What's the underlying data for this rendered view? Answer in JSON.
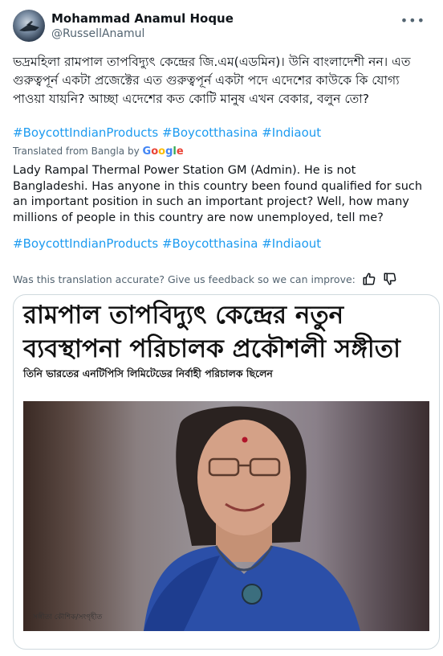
{
  "author": {
    "name": "Mohammad Anamul Hoque",
    "handle": "@RussellAnamul"
  },
  "tweet": {
    "text": "ভদ্রমহিলা রামপাল তাপবিদ্যুৎ কেন্দ্রের  জি.এম(এডমিন)। উনি বাংলাদেশী নন। এত গুরুত্বপূর্ন একটা প্রজেক্টের এত গুরুত্বপূর্ন একটা পদে এদেশের কাউকে কি যোগ্য পাওয়া যায়নি? আচ্ছা এদেশের কত কোটি মানুষ এখন বেকার, বলুন তো?",
    "hashtags": "#BoycottIndianProducts #Boycotthasina #Indiaout",
    "translated_from": "Translated from Bangla by",
    "google": [
      "G",
      "o",
      "o",
      "g",
      "l",
      "e"
    ],
    "translation": "Lady Rampal Thermal Power Station GM (Admin). He is not Bangladeshi. Has anyone in this country been found qualified for such an important position in such an important project? Well, how many millions of people in this country are now unemployed, tell me?",
    "hashtags_translated": "#BoycottIndianProducts #Boycotthasina #Indiaout",
    "feedback_prompt": "Was this translation accurate? Give us feedback so we can improve:"
  },
  "card": {
    "headline": "রামপাল তাপবিদ্যুৎ কেন্দ্রের নতুন ব্যবস্থাপনা পরিচালক প্রকৌশলী সঙ্গীতা",
    "subline": "তিনি ভারতের এনটিপিসি লিমিটেডের নির্বাহী পরিচালক ছিলেন",
    "photo_caption": "সঙ্গীতা কৌশিক/সংগৃহীত"
  },
  "colors": {
    "link": "#1d9bf0",
    "secondary_text": "#536471",
    "border": "#cfd9de"
  },
  "icons": [
    "more-icon",
    "thumbs-up-icon",
    "thumbs-down-icon"
  ]
}
